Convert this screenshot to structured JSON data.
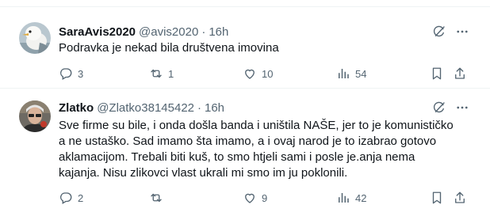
{
  "top": {
    "fragment": ""
  },
  "tweets": [
    {
      "name": "SaraAvis2020",
      "handle": "@avis2020",
      "dot": "·",
      "time": "16h",
      "lines": [
        "Podravka je nekad bila društvena imovina"
      ],
      "reply_count": "3",
      "retweet_count": "1",
      "like_count": "10",
      "view_count": "54"
    },
    {
      "name": "Zlatko",
      "handle": "@Zlatko38145422",
      "dot": "·",
      "time": "16h",
      "lines": [
        "Sve firme su bile, i onda došla banda i uništila NAŠE, jer to je komunističko",
        "a ne ustaško. Sad imamo šta imamo, a i ovaj narod je to izabrao gotovo",
        "aklamacijom. Trebali biti kuš, to smo htjeli sami i posle je.anja nema",
        "kajanja. Nisu zlikovci vlast ukrali mi smo im ju poklonili."
      ],
      "reply_count": "2",
      "retweet_count": "",
      "like_count": "9",
      "view_count": "42"
    }
  ],
  "colors": {
    "text": "#0f1419",
    "secondary": "#536471",
    "divider": "#eff3f4"
  }
}
